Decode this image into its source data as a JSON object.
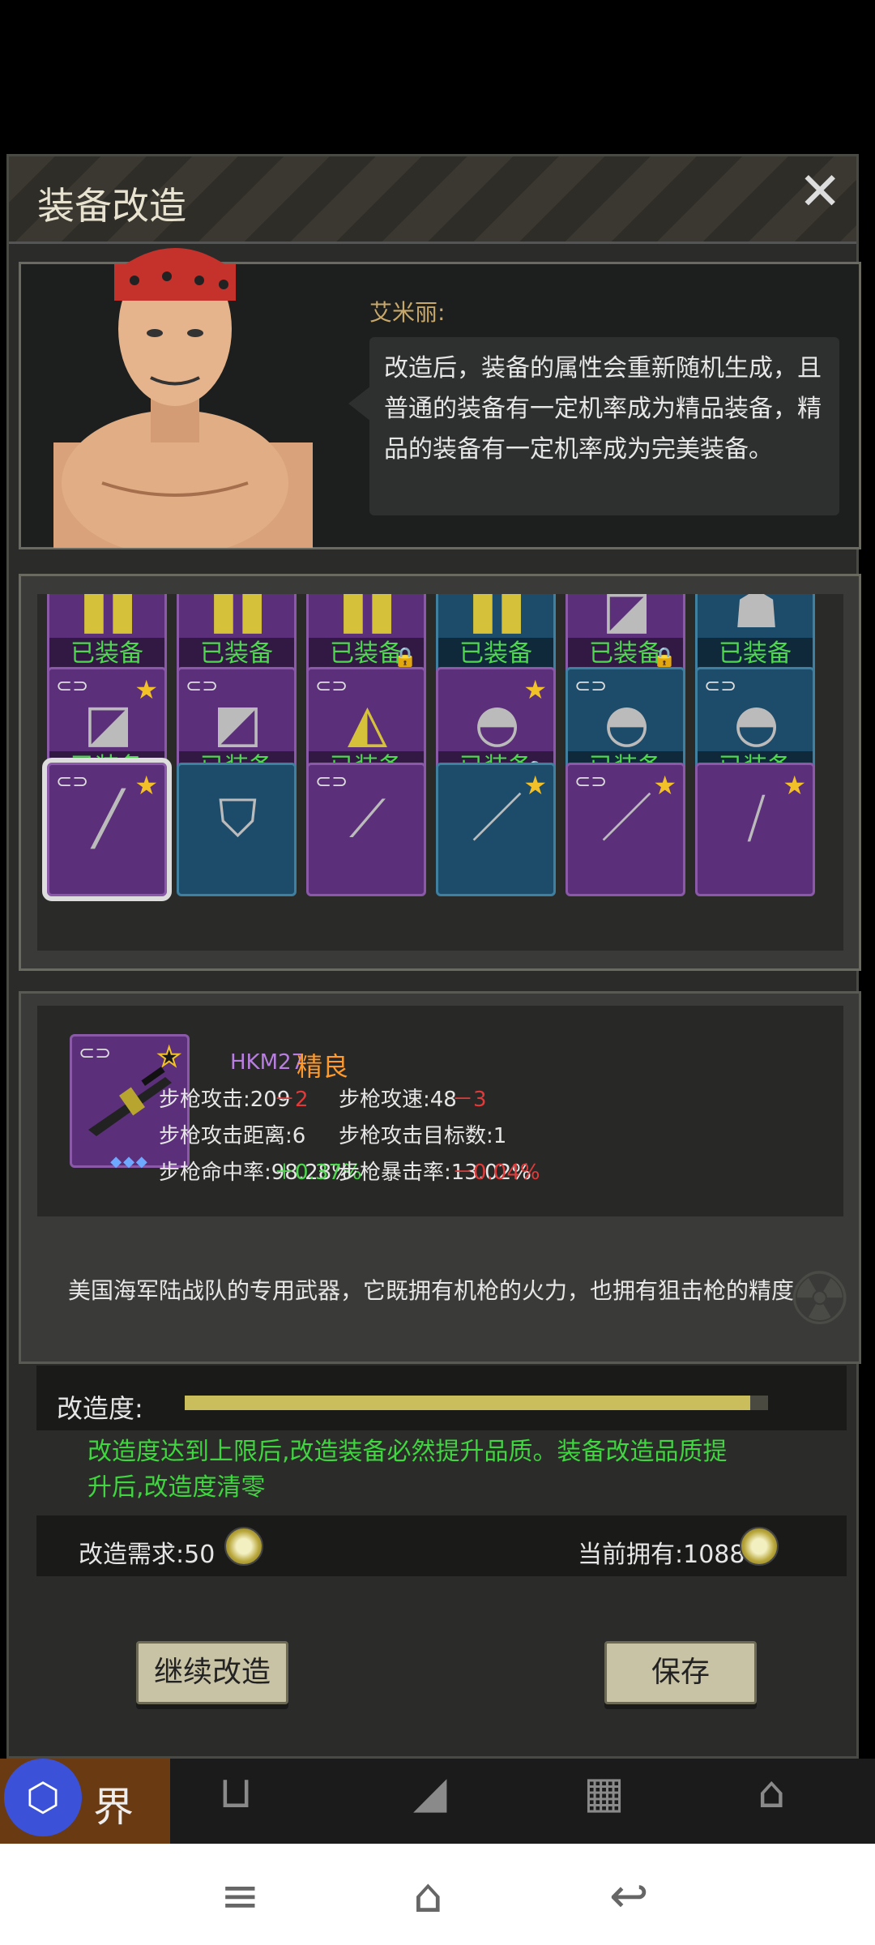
{
  "dialog": {
    "title": "装备改造",
    "close_icon": "close-icon"
  },
  "npc": {
    "name": "艾米丽:",
    "speech": "改造后，装备的属性会重新随机生成，且普通的装备有一定机率成为精品装备，精品的装备有一定机率成为完美装备。"
  },
  "inventory": {
    "equipped_label": "已装备",
    "rows": [
      [
        {
          "rarity": "purple",
          "equipped": true,
          "locked": false,
          "starred": false,
          "linked": false,
          "gems": "",
          "icon": "pants-icon"
        },
        {
          "rarity": "purple",
          "equipped": true,
          "locked": false,
          "starred": false,
          "linked": false,
          "gems": "",
          "icon": "pants-icon"
        },
        {
          "rarity": "purple",
          "equipped": true,
          "locked": true,
          "starred": false,
          "linked": false,
          "gems": "◆◆◆",
          "icon": "pants-icon"
        },
        {
          "rarity": "blue",
          "equipped": true,
          "locked": false,
          "starred": false,
          "linked": false,
          "gems": "",
          "icon": "pants-icon"
        },
        {
          "rarity": "purple",
          "equipped": true,
          "locked": true,
          "starred": false,
          "linked": false,
          "gems": "",
          "icon": "jacket-icon"
        },
        {
          "rarity": "blue",
          "equipped": true,
          "locked": false,
          "starred": false,
          "linked": false,
          "gems": "",
          "icon": "torso-icon"
        }
      ],
      [
        {
          "rarity": "purple",
          "equipped": true,
          "locked": true,
          "starred": true,
          "linked": true,
          "gems": "◆",
          "icon": "jacket-icon"
        },
        {
          "rarity": "purple",
          "equipped": true,
          "locked": false,
          "starred": false,
          "linked": true,
          "gems": "◆◆",
          "icon": "coat-icon"
        },
        {
          "rarity": "purple",
          "equipped": true,
          "locked": false,
          "starred": false,
          "linked": true,
          "gems": "",
          "icon": "hoodie-icon"
        },
        {
          "rarity": "purple",
          "equipped": true,
          "locked": true,
          "starred": true,
          "linked": false,
          "gems": "◆◆◆",
          "icon": "helmet-icon"
        },
        {
          "rarity": "blue",
          "equipped": true,
          "locked": false,
          "starred": false,
          "linked": true,
          "gems": "",
          "icon": "helmet-icon"
        },
        {
          "rarity": "blue",
          "equipped": true,
          "locked": false,
          "starred": false,
          "linked": true,
          "gems": "",
          "icon": "helmet-icon"
        }
      ],
      [
        {
          "rarity": "purple",
          "equipped": false,
          "locked": false,
          "starred": true,
          "linked": true,
          "gems": "",
          "icon": "rifle-icon",
          "selected": true
        },
        {
          "rarity": "blue",
          "equipped": false,
          "locked": false,
          "starred": false,
          "linked": false,
          "gems": "",
          "icon": "shield-icon"
        },
        {
          "rarity": "purple",
          "equipped": false,
          "locked": false,
          "starred": false,
          "linked": true,
          "gems": "",
          "icon": "blade-icon"
        },
        {
          "rarity": "blue",
          "equipped": false,
          "locked": false,
          "starred": true,
          "linked": false,
          "gems": "",
          "icon": "spear-icon"
        },
        {
          "rarity": "purple",
          "equipped": false,
          "locked": false,
          "starred": true,
          "linked": true,
          "gems": "",
          "icon": "spear-icon"
        },
        {
          "rarity": "purple",
          "equipped": false,
          "locked": false,
          "starred": true,
          "linked": false,
          "gems": "",
          "icon": "machete-icon"
        }
      ]
    ]
  },
  "detail": {
    "name": "HKM27",
    "quality": "精良",
    "gems": "◆◆◆",
    "stats": {
      "attack": "步枪攻击:209",
      "attack_delta": "－2",
      "speed": "步枪攻速:48",
      "speed_delta": "－3",
      "range": "步枪攻击距离:6",
      "targets": "步枪攻击目标数:1",
      "accuracy": "步枪命中率:98.28%",
      "accuracy_delta": "＋0.37%",
      "crit": "步枪暴击率:13.02%",
      "crit_delta": "－0.04%"
    },
    "description": "美国海军陆战队的专用武器，它既拥有机枪的火力，也拥有狙击枪的精度"
  },
  "progress": {
    "label": "改造度:",
    "fraction": 0.97,
    "note": "改造度达到上限后,改造装备必然提升品质。装备改造品质提升后,改造度清零"
  },
  "cost": {
    "required": "改造需求:50",
    "owned": "当前拥有:1088"
  },
  "buttons": {
    "continue": "继续改造",
    "save": "保存"
  },
  "tabs": {
    "world": "界"
  },
  "colors": {
    "purple_rarity": "#5b2f7a",
    "blue_rarity": "#1d4c6b",
    "equipped_green": "#4fd84f",
    "quality_orange": "#ff9a2a",
    "negative_red": "#e03a3a"
  }
}
